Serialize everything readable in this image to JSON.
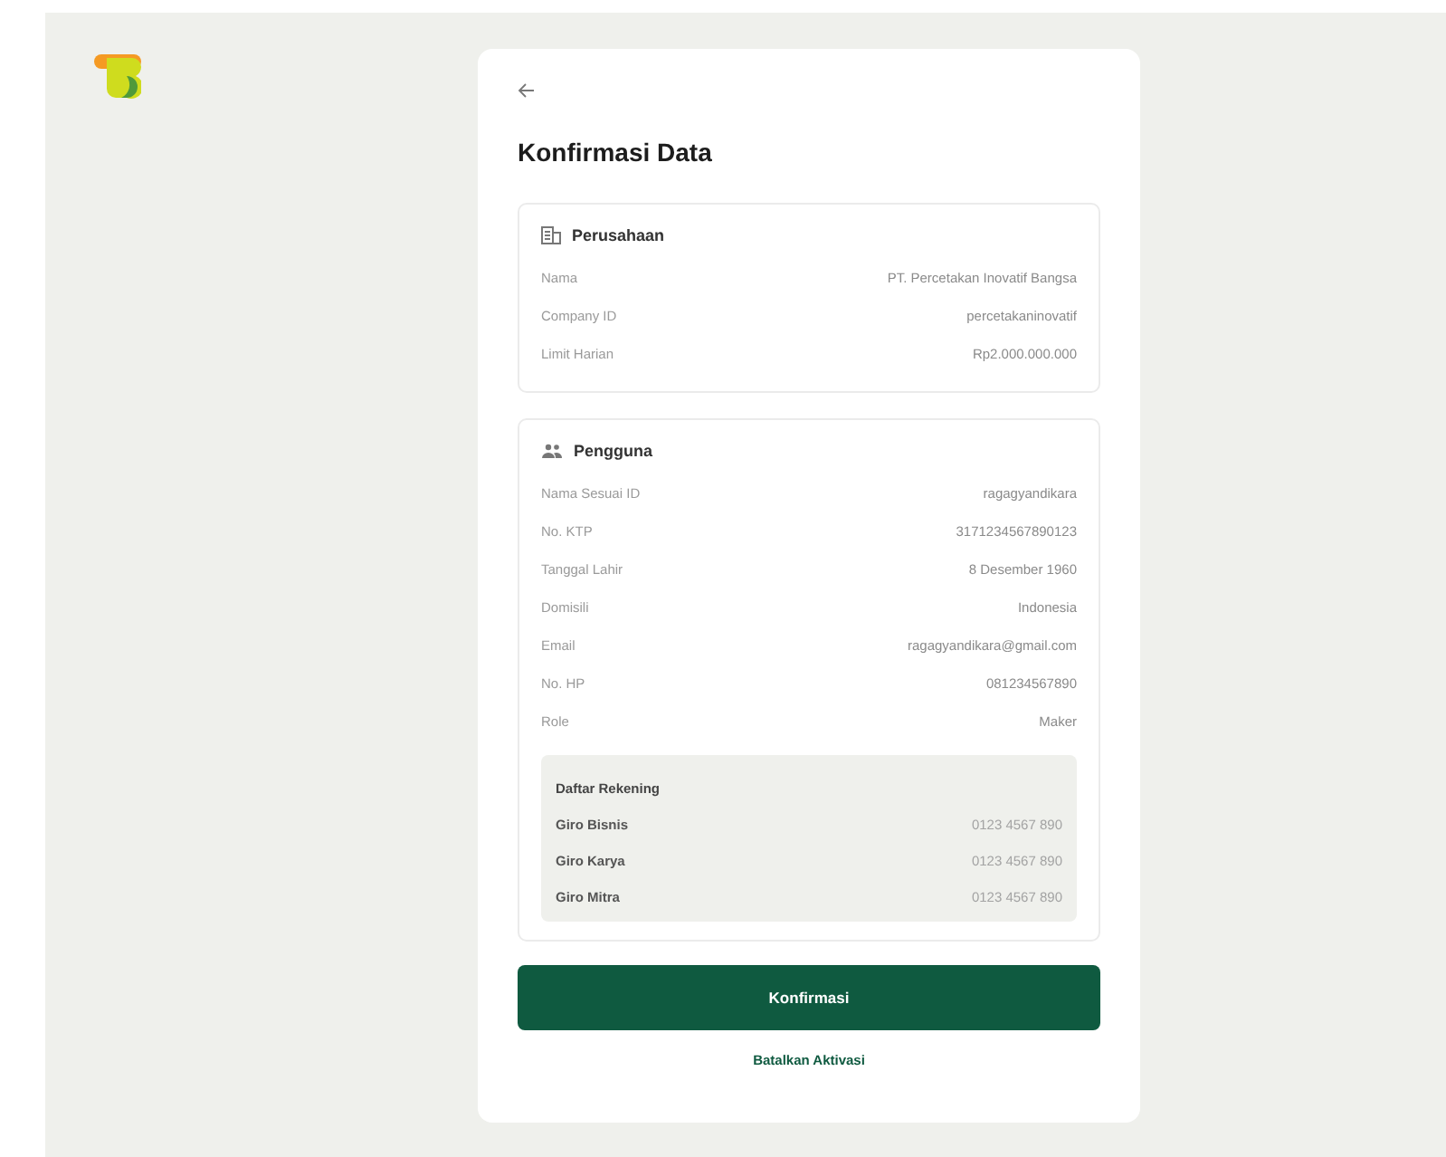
{
  "title": "Konfirmasi Data",
  "company": {
    "heading": "Perusahaan",
    "rows": [
      {
        "label": "Nama",
        "value": "PT. Percetakan Inovatif Bangsa"
      },
      {
        "label": "Company ID",
        "value": "percetakaninovatif"
      },
      {
        "label": "Limit Harian",
        "value": "Rp2.000.000.000"
      }
    ]
  },
  "user": {
    "heading": "Pengguna",
    "rows": [
      {
        "label": "Nama Sesuai ID",
        "value": "ragagyandikara"
      },
      {
        "label": "No. KTP",
        "value": "3171234567890123"
      },
      {
        "label": "Tanggal Lahir",
        "value": "8 Desember 1960"
      },
      {
        "label": "Domisili",
        "value": "Indonesia"
      },
      {
        "label": "Email",
        "value": "ragagyandikara@gmail.com"
      },
      {
        "label": "No. HP",
        "value": "081234567890"
      },
      {
        "label": "Role",
        "value": "Maker"
      }
    ],
    "accounts": {
      "heading": "Daftar Rekening",
      "rows": [
        {
          "name": "Giro Bisnis",
          "number": "0123 4567 890"
        },
        {
          "name": "Giro Karya",
          "number": "0123 4567 890"
        },
        {
          "name": "Giro Mitra",
          "number": "0123 4567 890"
        }
      ]
    }
  },
  "confirm_button": "Konfirmasi",
  "cancel_link": "Batalkan Aktivasi"
}
